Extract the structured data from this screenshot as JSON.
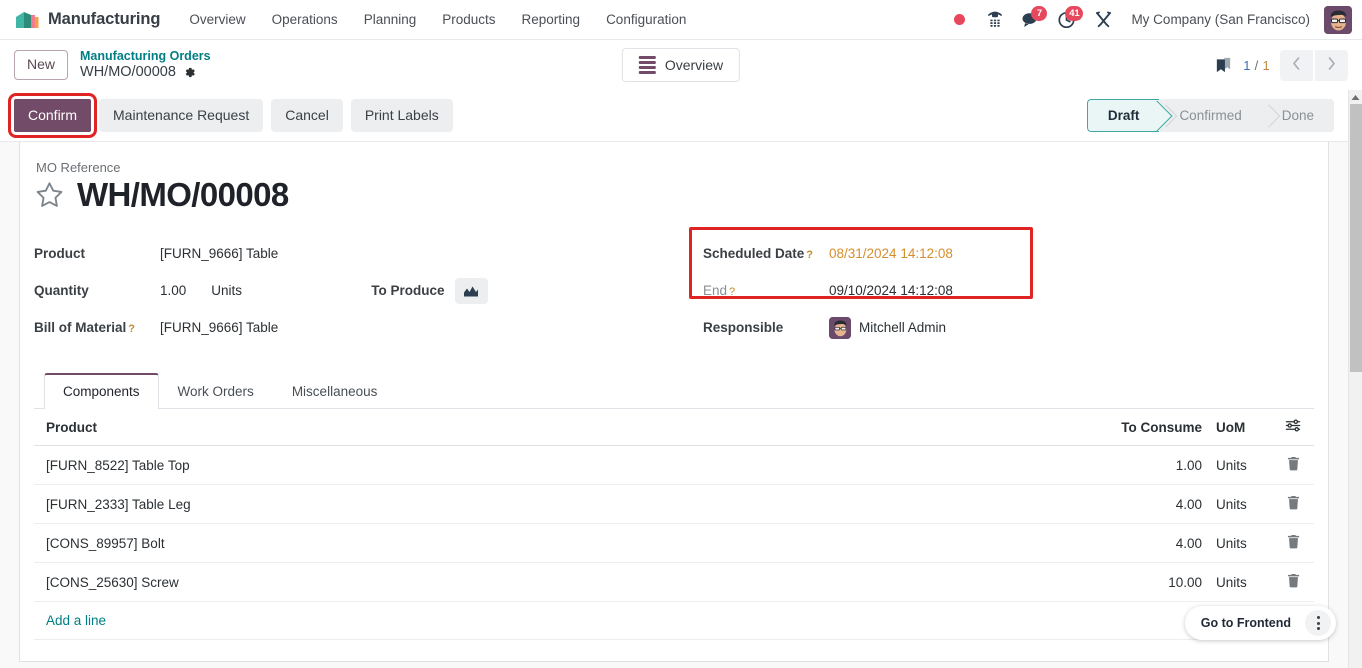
{
  "navbar": {
    "brand": "Manufacturing",
    "brand_logo_icon": "manufacturing-logo-icon",
    "menu": [
      {
        "label": "Overview"
      },
      {
        "label": "Operations"
      },
      {
        "label": "Planning"
      },
      {
        "label": "Products"
      },
      {
        "label": "Reporting"
      },
      {
        "label": "Configuration"
      }
    ],
    "systray": {
      "record_icon": "record-dot-icon",
      "phone_icon": "dialpad-phone-icon",
      "messages_icon": "chat-bubble-icon",
      "messages_count": "7",
      "activities_icon": "clock-activity-icon",
      "activities_count": "41",
      "tools_icon": "wrench-tools-icon",
      "company": "My Company (San Francisco)",
      "avatar_icon": "user-avatar"
    }
  },
  "controlpanel": {
    "new_button": "New",
    "breadcrumb_parent": "Manufacturing Orders",
    "breadcrumb_current": "WH/MO/00008",
    "settings_icon": "gear-icon",
    "overview_button": "Overview",
    "overview_icon": "list-lines-icon",
    "bookmark_icon": "bookmark-flag-icon",
    "pager_current": "1",
    "pager_separator": " / ",
    "pager_total": "1",
    "prev_icon": "chevron-left-icon",
    "next_icon": "chevron-right-icon"
  },
  "actions": {
    "confirm": "Confirm",
    "maintenance_request": "Maintenance Request",
    "cancel": "Cancel",
    "print_labels": "Print Labels",
    "highlight_color": "#e02424"
  },
  "status": {
    "stages": [
      {
        "label": "Draft",
        "active": true
      },
      {
        "label": "Confirmed",
        "active": false
      },
      {
        "label": "Done",
        "active": false
      }
    ],
    "active_color": "#3ea8a0"
  },
  "record": {
    "reference_label": "MO Reference",
    "star_icon": "star-outline-icon",
    "title": "WH/MO/00008",
    "fields": {
      "product_label": "Product",
      "product_value": "[FURN_9666] Table",
      "quantity_label": "Quantity",
      "quantity_value": "1.00",
      "quantity_uom": "Units",
      "to_produce_label": "To Produce",
      "to_produce_icon": "area-chart-icon",
      "bom_label": "Bill of Material",
      "bom_help": "?",
      "bom_value": "[FURN_9666] Table",
      "scheduled_date_label": "Scheduled Date",
      "scheduled_date_help": "?",
      "scheduled_date_value": "08/31/2024 14:12:08",
      "scheduled_date_color": "#d48f2c",
      "end_label": "End",
      "end_help": "?",
      "end_value": "09/10/2024 14:12:08",
      "responsible_label": "Responsible",
      "responsible_value": "Mitchell Admin",
      "responsible_avatar_icon": "user-avatar"
    }
  },
  "notebook": {
    "tabs": [
      {
        "label": "Components",
        "active": true
      },
      {
        "label": "Work Orders",
        "active": false
      },
      {
        "label": "Miscellaneous",
        "active": false
      }
    ],
    "table": {
      "headers": {
        "product": "Product",
        "to_consume": "To Consume",
        "uom": "UoM",
        "settings_icon": "column-settings-icon"
      },
      "rows": [
        {
          "product": "[FURN_8522] Table Top",
          "to_consume": "1.00",
          "uom": "Units",
          "delete_icon": "trash-icon"
        },
        {
          "product": "[FURN_2333] Table Leg",
          "to_consume": "4.00",
          "uom": "Units",
          "delete_icon": "trash-icon"
        },
        {
          "product": "[CONS_89957] Bolt",
          "to_consume": "4.00",
          "uom": "Units",
          "delete_icon": "trash-icon"
        },
        {
          "product": "[CONS_25630] Screw",
          "to_consume": "10.00",
          "uom": "Units",
          "delete_icon": "trash-icon"
        }
      ],
      "add_line": "Add a line"
    }
  },
  "frontend_widget": {
    "label": "Go to Frontend",
    "menu_icon": "vertical-dots-icon"
  },
  "scrollbar": {
    "up_icon": "scroll-up-arrow-icon",
    "thumb": "scrollbar-thumb"
  }
}
